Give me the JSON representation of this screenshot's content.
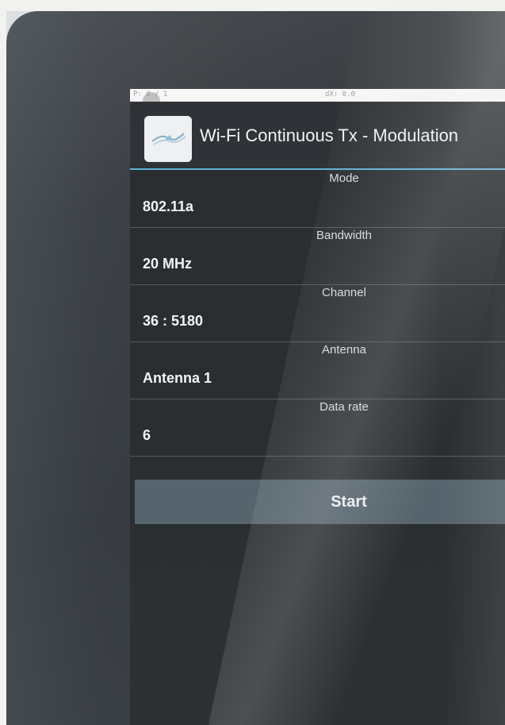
{
  "status_bar": {
    "left_text": "P: 0 / 1",
    "center_text": "dX: 0.0"
  },
  "app": {
    "title": "Wi-Fi Continuous Tx - Modulation",
    "icon": "app-logo-icon"
  },
  "settings": [
    {
      "label": "Mode",
      "value": "802.11a"
    },
    {
      "label": "Bandwidth",
      "value": "20 MHz"
    },
    {
      "label": "Channel",
      "value": "36 : 5180"
    },
    {
      "label": "Antenna",
      "value": "Antenna 1"
    },
    {
      "label": "Data rate",
      "value": "6"
    }
  ],
  "start_button": {
    "label": "Start"
  },
  "colors": {
    "accent_line": "#5fb3d6",
    "button_bg": "#56646d",
    "screen_bg": "#2b2e31"
  }
}
